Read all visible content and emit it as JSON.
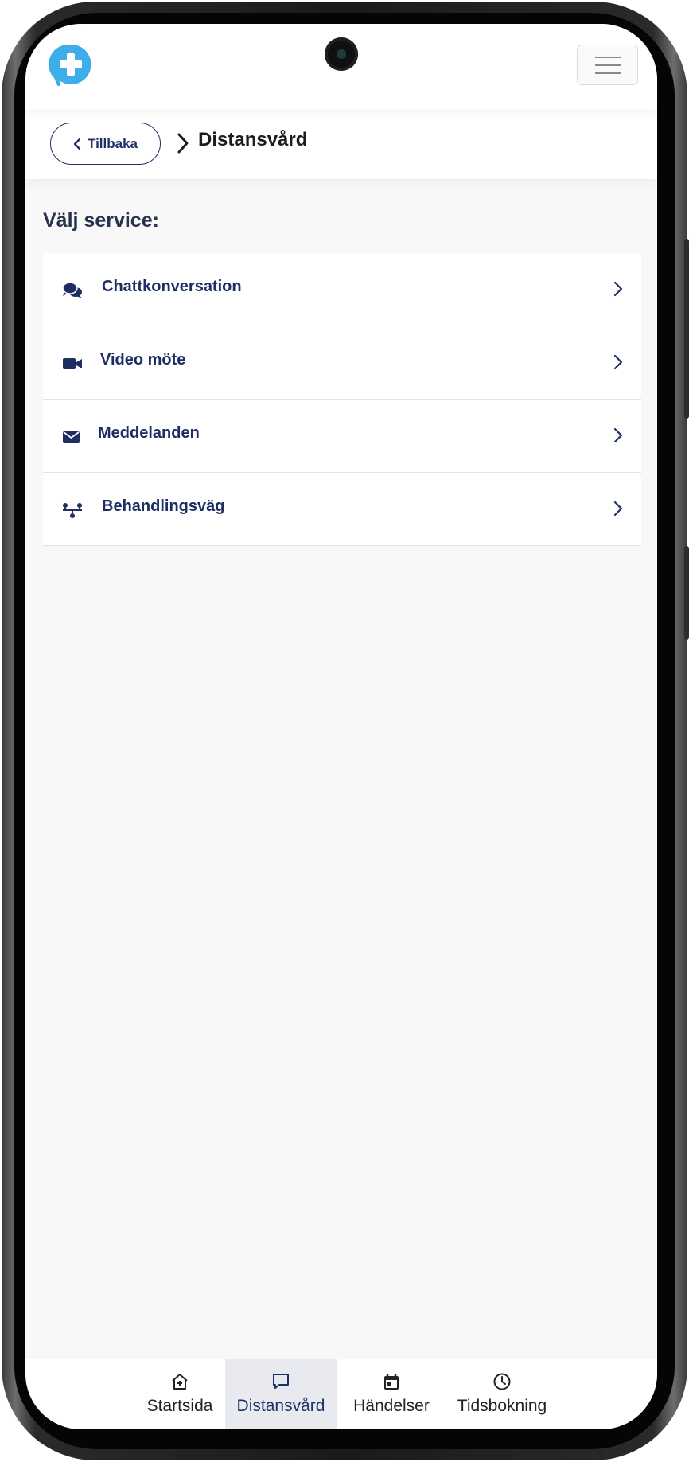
{
  "header": {
    "logo_icon": "medical-cross-chat-icon",
    "menu_icon": "hamburger-menu-icon"
  },
  "breadcrumb": {
    "back_label": "Tillbaka",
    "current": "Distansvård"
  },
  "section_title": "Välj service:",
  "services": [
    {
      "label": "Chattkonversation",
      "icon": "chat-bubbles-icon"
    },
    {
      "label": "Video möte",
      "icon": "video-camera-icon"
    },
    {
      "label": "Meddelanden",
      "icon": "envelope-icon"
    },
    {
      "label": "Behandlingsväg",
      "icon": "treatment-path-icon"
    }
  ],
  "bottom_nav": [
    {
      "label": "Startsida",
      "icon": "home-icon",
      "active": false
    },
    {
      "label": "Distansvård",
      "icon": "chat-bubble-icon",
      "active": true
    },
    {
      "label": "Händelser",
      "icon": "calendar-icon",
      "active": false
    },
    {
      "label": "Tidsbokning",
      "icon": "clock-icon",
      "active": false
    }
  ],
  "colors": {
    "brand": "#1d3168",
    "logo": "#3daee9",
    "active_nav_bg": "#e8eaf0",
    "background": "#f8f8f8"
  }
}
